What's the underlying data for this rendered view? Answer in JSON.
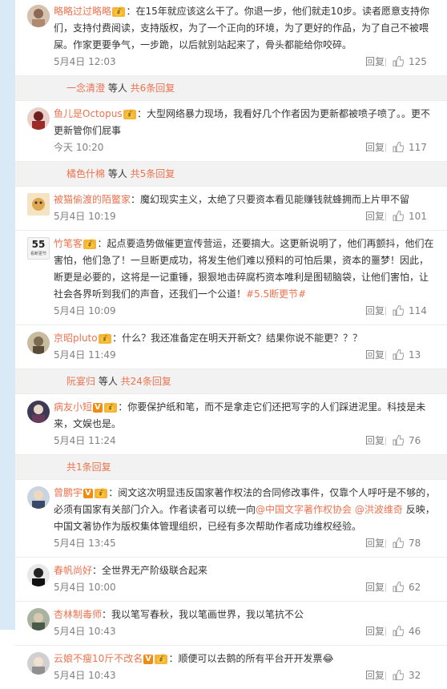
{
  "comments": [
    {
      "user": "略略过过略略",
      "badge": "💰",
      "text": "：在15年就应该这么干了。你退一步，他们就走10步。读者愿意支持你们，支持付费阅读，支持版权，为了一个正向的环境，为了更好的作品，为了自己不被喂屎。作家更要争气，一步跪，以后就别站起来了，骨头都能给你咬碎。",
      "time": "5月4日 12:03",
      "reply": "回复",
      "likes": "125",
      "avatar_color": "#c8a896"
    },
    {
      "user": "鱼儿是Octopus",
      "badge": "💰",
      "text": "：大型网络暴力现场，我看好几个作者因为更新都被喷子喷了。。更不更新管你们屁事",
      "time": "今天 10:20",
      "reply": "回复",
      "likes": "117",
      "avatar_color": "#8c2b2b"
    },
    {
      "user": "被猫偷渡的陌鳖家",
      "badge": "",
      "text": "：魔幻现实主义，太绝了只要资本看见能赚钱就蜂拥而上片甲不留",
      "time": "5月4日 10:19",
      "reply": "回复",
      "likes": "101",
      "avatar_color": "#e0b868"
    },
    {
      "user": "竹笔客",
      "badge": "💰",
      "text": "：起点要造势做催更宣传营运，还要搞大。这更新说明了，他们再颤抖，他们在害怕，他们急了！一旦断更成功，将发生他们难以预料的可怕后果，资本的噩梦！因此，断更是必要的，这将是一记重锤，狠狠地击碎腐朽资本唯利是图韧脑袋，让他们害怕，让社会各界听到我们的声音，还我们一个公道！",
      "tag": "#5.5断更节#",
      "time": "5月4日 10:09",
      "reply": "回复",
      "likes": "114",
      "avatar_text": "55",
      "avatar_sub": "看断更节"
    },
    {
      "user": "京昭pluto",
      "badge": "💰",
      "text": "：什么？我还准备定在明天开新文？结果你说不能更？？？",
      "time": "5月4日 11:49",
      "reply": "回复",
      "likes": "13",
      "avatar_color": "#9a8a70"
    },
    {
      "user": "病友小短",
      "badge": "V",
      "badge2": "💰",
      "text": "：你要保护纸和笔，而不是拿走它们还把写字的人们踩进泥里。科技是未来，文娱也是。",
      "time": "5月4日 11:24",
      "reply": "回复",
      "likes": "76",
      "avatar_color": "#4a4560"
    },
    {
      "user": "曾鹏宇",
      "badge": "V",
      "badge2": "💰",
      "text_parts": [
        "：阅文这次明显违反国家著作权法的合同修改事件，仅靠个人呼吁是不够的，必须有国家有关部门介入。作者读者可以统一向",
        "@中国文字著作权协会",
        "@洪波维奇",
        "反映，中国文著协作为版权集体管理组织，已经有多次帮助作者成功维权经验。"
      ],
      "time": "5月4日 13:45",
      "reply": "回复",
      "likes": "78",
      "avatar_color": "#5b6f86"
    },
    {
      "user": "春帆尚好",
      "badge": "",
      "text": "：全世界无产阶级联合起来",
      "time": "5月4日 10:00",
      "reply": "回复",
      "likes": "62",
      "avatar_color": "#2b2b2b"
    },
    {
      "user": "杏林制毒师",
      "badge": "",
      "text": "：我以笔写春秋，我以笔画世界，我以笔抗不公",
      "time": "5月4日 10:43",
      "reply": "回复",
      "likes": "46",
      "avatar_color": "#6a7a6a"
    },
    {
      "user": "云娘不瘦10斤不改名",
      "badge": "V",
      "badge2": "💰",
      "text": "：顺便可以去鹅的所有平台开开发票",
      "time": "5月4日 10:43",
      "reply": "回复",
      "likes": "32",
      "avatar_color": "#b0b0b0"
    }
  ],
  "more_rows": [
    {
      "user": "一念清澄",
      "mid": " 等人 ",
      "cnt": "共6条回复"
    },
    {
      "user": "橘色什棉",
      "mid": " 等人 ",
      "cnt": "共5条回复"
    },
    {
      "user": "阮宴归",
      "mid": " 等人 ",
      "cnt": "共24条回复"
    },
    {
      "user": "",
      "mid": "",
      "cnt": "共1条回复"
    }
  ]
}
